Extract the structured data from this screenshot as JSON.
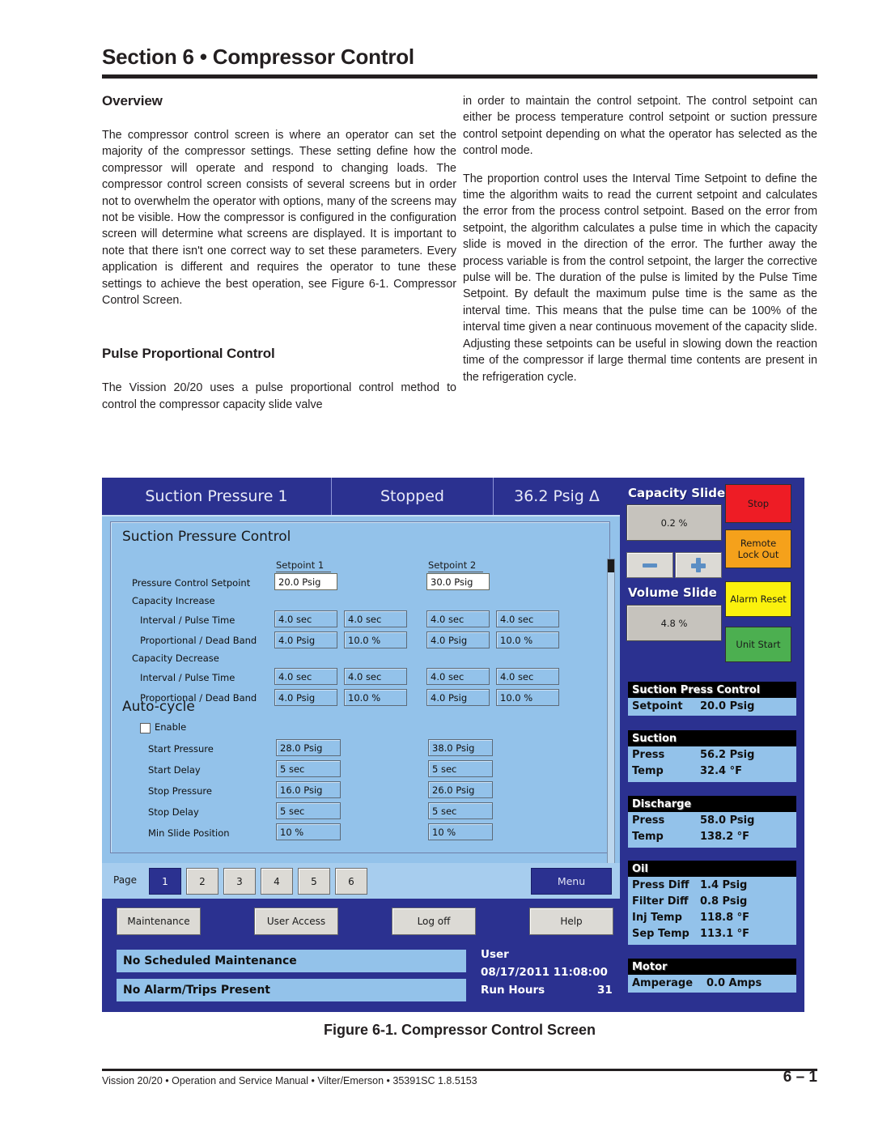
{
  "header": {
    "section_title": "Section 6 • Compressor Control"
  },
  "left_column": {
    "overview_heading": "Overview",
    "overview_body": "The compressor control screen is where an operator can set the majority of the compressor settings. These setting define how the compressor will operate and respond to changing loads. The compressor control screen consists of several screens but in order not to overwhelm the operator with options, many of the screens may not be visible. How the compressor is configured in the configuration screen will determine what screens are displayed. It is important to note that there isn't one correct way to set these parameters. Every application is different and requires the operator to tune these settings to achieve the best operation, see Figure 6-1. Compressor Control Screen.",
    "pulse_heading": "Pulse Proportional Control",
    "pulse_body": "The Vission 20/20 uses a pulse proportional control method to control the compressor capacity slide valve"
  },
  "right_column": {
    "para1": "in order to maintain the control setpoint. The control setpoint can either be process temperature control setpoint or suction pressure control setpoint depending on what the operator has selected as the control mode.",
    "para2": "The proportion control uses the Interval Time Setpoint to define the time the algorithm waits to read the current setpoint and calculates the error from the process control setpoint. Based on the error from setpoint, the algorithm calculates a pulse time in which the capacity slide is moved in the direction of the error. The further away the process variable is from the control setpoint, the larger the corrective pulse will be. The duration of the pulse is limited by the Pulse Time Setpoint. By default the maximum pulse time is the same as the interval time. This means that the pulse time can be 100% of the interval time given a near continuous movement of the capacity slide. Adjusting these setpoints can be useful in slowing down the reaction time of the compressor if large thermal time contents are present in the refrigeration cycle."
  },
  "hmi": {
    "topbar": {
      "mode": "Suction Pressure 1",
      "status": "Stopped",
      "delta": "36.2 Psig Δ"
    },
    "panel": {
      "title": "Suction Pressure Control",
      "setpoint1_header": "Setpoint 1",
      "setpoint2_header": "Setpoint 2",
      "rows": {
        "pressure_control_setpoint": "Pressure Control Setpoint",
        "capacity_increase": "Capacity Increase",
        "capacity_decrease": "Capacity Decrease",
        "interval_pulse_time": "Interval / Pulse Time",
        "proportional_dead_band": "Proportional / Dead Band"
      },
      "values": {
        "sp1_pressure": "20.0 Psig",
        "sp2_pressure": "30.0 Psig",
        "inc_sp1_interval": "4.0 sec",
        "inc_sp1_pulse": "4.0 sec",
        "inc_sp2_interval": "4.0 sec",
        "inc_sp2_pulse": "4.0 sec",
        "inc_sp1_prop": "4.0 Psig",
        "inc_sp1_dead": "10.0 %",
        "inc_sp2_prop": "4.0 Psig",
        "inc_sp2_dead": "10.0 %",
        "dec_sp1_interval": "4.0 sec",
        "dec_sp1_pulse": "4.0 sec",
        "dec_sp2_interval": "4.0 sec",
        "dec_sp2_pulse": "4.0 sec",
        "dec_sp1_prop": "4.0 Psig",
        "dec_sp1_dead": "10.0 %",
        "dec_sp2_prop": "4.0 Psig",
        "dec_sp2_dead": "10.0 %"
      }
    },
    "autocycle": {
      "title": "Auto-cycle",
      "enable_label": "Enable",
      "enabled": false,
      "labels": {
        "start_pressure": "Start Pressure",
        "start_delay": "Start Delay",
        "stop_pressure": "Stop Pressure",
        "stop_delay": "Stop Delay",
        "min_slide_position": "Min Slide Position"
      },
      "values": {
        "start_pressure_1": "28.0 Psig",
        "start_pressure_2": "38.0 Psig",
        "start_delay_1": "5 sec",
        "start_delay_2": "5 sec",
        "stop_pressure_1": "16.0 Psig",
        "stop_pressure_2": "26.0 Psig",
        "stop_delay_1": "5 sec",
        "stop_delay_2": "5 sec",
        "min_slide_1": "10 %",
        "min_slide_2": "10 %"
      }
    },
    "pager": {
      "label": "Page",
      "pages": [
        "1",
        "2",
        "3",
        "4",
        "5",
        "6"
      ],
      "active_page": "1",
      "menu_label": "Menu"
    },
    "actions": {
      "maintenance": "Maintenance",
      "user_access": "User Access",
      "log_off": "Log off",
      "help": "Help"
    },
    "status": {
      "maintenance_status": "No Scheduled Maintenance",
      "alarm_status": "No Alarm/Trips Present",
      "user_label": "User",
      "datetime": "08/17/2011  11:08:00",
      "run_hours_label": "Run Hours",
      "run_hours_value": "31"
    },
    "rail": {
      "capacity_slide_label": "Capacity Slide",
      "capacity_slide_value": "0.2 %",
      "capacity_decrease_icon": "minus-icon",
      "capacity_increase_icon": "plus-icon",
      "volume_slide_label": "Volume Slide",
      "volume_slide_value": "4.8 %",
      "buttons": [
        {
          "label": "Stop",
          "color": "#ee1c25"
        },
        {
          "label": "Remote\nLock Out",
          "color": "#f5a11b"
        },
        {
          "label": "Alarm Reset",
          "color": "#fbf10d"
        },
        {
          "label": "Unit Start",
          "color": "#4caf50"
        }
      ],
      "btn_stop": "Stop",
      "btn_remote_l1": "Remote",
      "btn_remote_l2": "Lock Out",
      "btn_alarm_reset": "Alarm Reset",
      "btn_unit_start": "Unit Start"
    },
    "readouts": [
      {
        "title": "Suction Press Control",
        "rows": [
          {
            "k": "Setpoint",
            "v": "20.0 Psig"
          }
        ]
      },
      {
        "title": "Suction",
        "rows": [
          {
            "k": "Press",
            "v": "56.2 Psig"
          },
          {
            "k": "Temp",
            "v": "32.4 °F"
          }
        ]
      },
      {
        "title": "Discharge",
        "rows": [
          {
            "k": "Press",
            "v": "58.0 Psig"
          },
          {
            "k": "Temp",
            "v": "138.2 °F"
          }
        ]
      },
      {
        "title": "Oil",
        "rows": [
          {
            "k": "Press Diff",
            "v": "1.4 Psig"
          },
          {
            "k": "Filter Diff",
            "v": "0.8 Psig"
          },
          {
            "k": "Inj Temp",
            "v": "118.8 °F"
          },
          {
            "k": "Sep Temp",
            "v": "113.1 °F"
          }
        ]
      },
      {
        "title": "Motor",
        "rows": [
          {
            "k": "Amperage",
            "v": "0.0 Amps"
          }
        ]
      }
    ]
  },
  "figure_caption": "Figure 6-1. Compressor Control Screen",
  "footer": {
    "left": "Vission 20/20 • Operation and Service Manual • Vilter/Emerson • 35391SC 1.8.5153",
    "page_number": "6 – 1"
  }
}
